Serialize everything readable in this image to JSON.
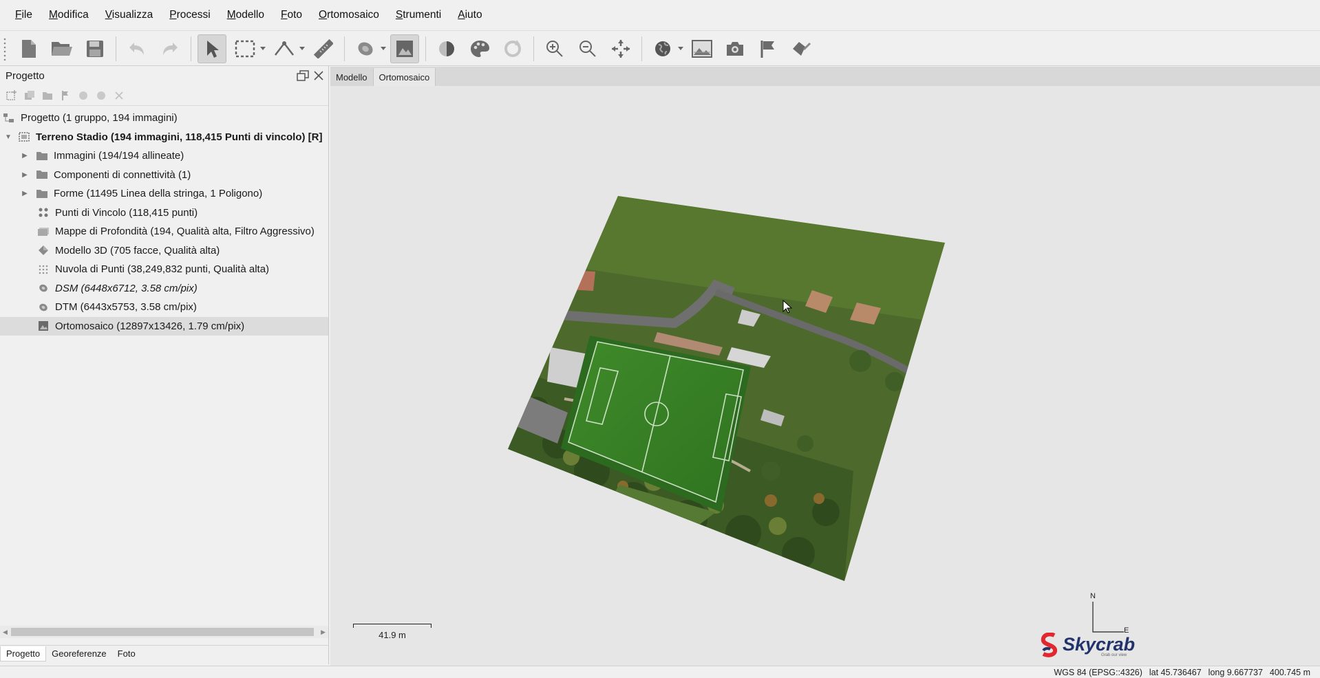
{
  "menu": [
    {
      "label": "File",
      "u": "F",
      "rest": "ile"
    },
    {
      "label": "Modifica",
      "u": "M",
      "rest": "odifica"
    },
    {
      "label": "Visualizza",
      "u": "V",
      "rest": "isualizza"
    },
    {
      "label": "Processi",
      "u": "P",
      "rest": "rocessi"
    },
    {
      "label": "Modello",
      "u": "M",
      "rest": "odello"
    },
    {
      "label": "Foto",
      "u": "F",
      "rest": "oto"
    },
    {
      "label": "Ortomosaico",
      "u": "O",
      "rest": "rtomosaico"
    },
    {
      "label": "Strumenti",
      "u": "S",
      "rest": "trumenti"
    },
    {
      "label": "Aiuto",
      "u": "A",
      "rest": "iuto"
    }
  ],
  "panel": {
    "title": "Progetto"
  },
  "tree": {
    "root": "Progetto (1 gruppo, 194 immagini)",
    "chunk": "Terreno Stadio (194 immagini, 118,415 Punti di vincolo) [R]",
    "items": [
      {
        "label": "Immagini (194/194 allineate)"
      },
      {
        "label": "Componenti di connettività (1)"
      },
      {
        "label": "Forme (11495 Linea della stringa, 1 Poligono)"
      },
      {
        "label": "Punti di Vincolo (118,415 punti)"
      },
      {
        "label": "Mappe di Profondità (194, Qualità alta, Filtro Aggressivo)"
      },
      {
        "label": "Modello 3D (705 facce, Qualità alta)"
      },
      {
        "label": "Nuvola di Punti (38,249,832 punti, Qualità alta)"
      },
      {
        "label": "DSM (6448x6712, 3.58 cm/pix)"
      },
      {
        "label": "DTM (6443x5753, 3.58 cm/pix)"
      },
      {
        "label": "Ortomosaico (12897x13426, 1.79 cm/pix)"
      }
    ]
  },
  "bottom_tabs": [
    "Progetto",
    "Georeferenze",
    "Foto"
  ],
  "view_tabs": [
    "Modello",
    "Ortomosaico"
  ],
  "scale": "41.9 m",
  "compass": {
    "n": "N",
    "e": "E"
  },
  "logo": {
    "name": "Skycrab",
    "tagline": "Grab our view"
  },
  "status": {
    "crs": "WGS 84 (EPSG::4326)",
    "lat": "lat 45.736467",
    "long": "long 9.667737",
    "alt": "400.745 m"
  }
}
